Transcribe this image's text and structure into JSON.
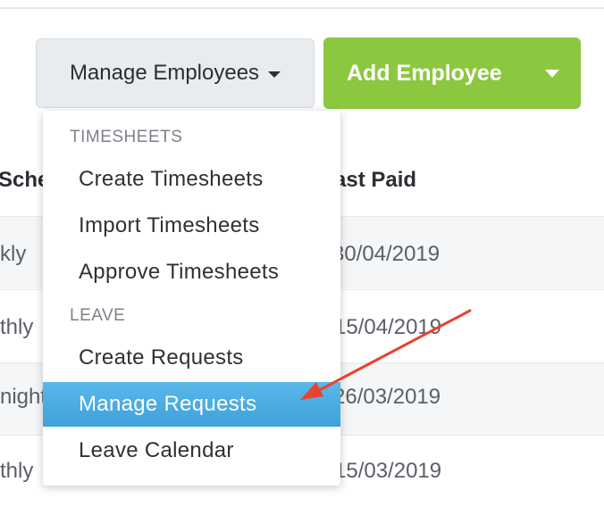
{
  "toolbar": {
    "manage_employees_label": "Manage Employees",
    "add_employee_label": "Add Employee"
  },
  "table": {
    "columns": {
      "schedule": "Sche",
      "last_paid": "ast Paid"
    },
    "rows": [
      {
        "schedule": "kly",
        "last_paid": "30/04/2019"
      },
      {
        "schedule": "thly",
        "last_paid": "15/04/2019"
      },
      {
        "schedule": "night",
        "last_paid": "26/03/2019"
      },
      {
        "schedule": "thly",
        "last_paid": "15/03/2019"
      }
    ]
  },
  "dropdown": {
    "sections": [
      {
        "header": "TIMESHEETS",
        "items": [
          "Create Timesheets",
          "Import Timesheets",
          "Approve Timesheets"
        ]
      },
      {
        "header": "LEAVE",
        "items": [
          "Create Requests",
          "Manage Requests",
          "Leave Calendar"
        ]
      }
    ],
    "active_item": "Manage Requests"
  },
  "colors": {
    "add_button": "#8cc83f",
    "active_item": "#4aabdf",
    "annotation_arrow": "#e8432e"
  }
}
